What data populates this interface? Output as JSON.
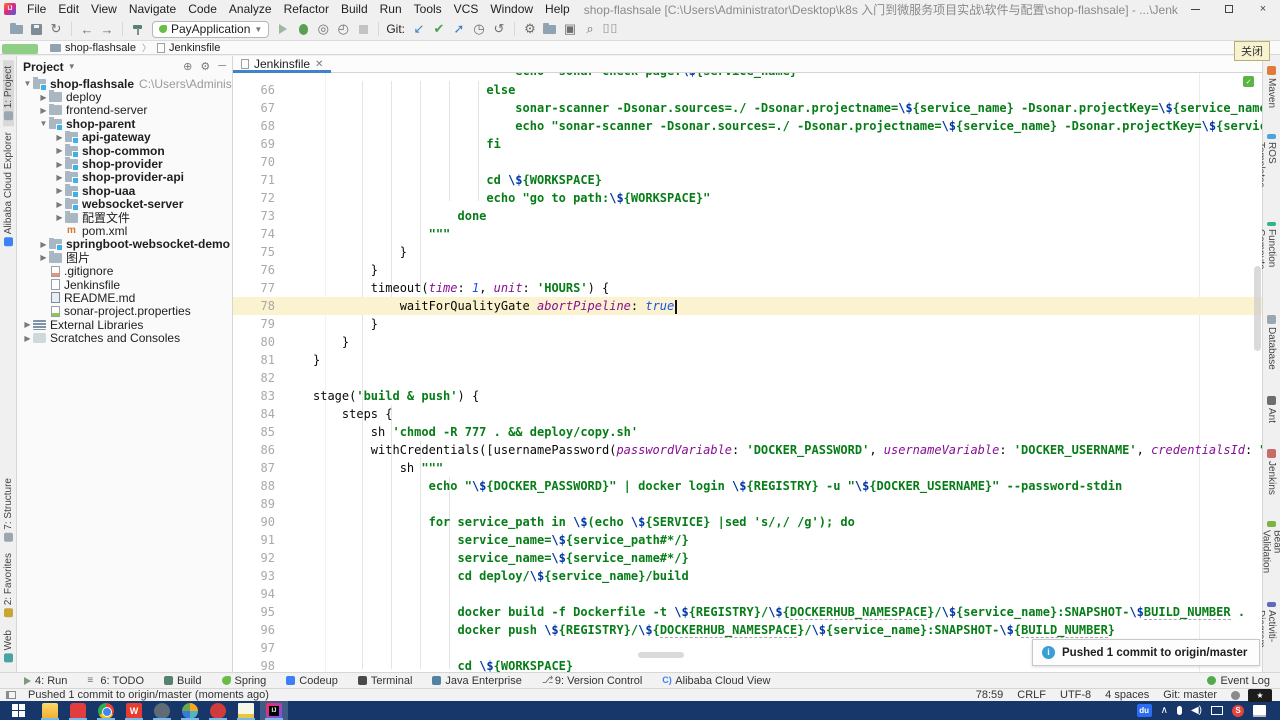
{
  "window": {
    "title": "shop-flashsale [C:\\Users\\Administrator\\Desktop\\k8s 入门到微服务项目实战\\软件与配置\\shop-flashsale] - ...\\Jenkinsfile [shop-flashsale] - IntelliJ IDEA (Administrator)",
    "menus": [
      "File",
      "Edit",
      "View",
      "Navigate",
      "Code",
      "Analyze",
      "Refactor",
      "Build",
      "Run",
      "Tools",
      "VCS",
      "Window",
      "Help"
    ]
  },
  "toolbar": {
    "run_config": "PayApplication",
    "git_label": "Git:"
  },
  "crumbs": {
    "items": [
      "shop-flashsale",
      "Jenkinsfile"
    ]
  },
  "tooltip": {
    "text": "关闭"
  },
  "strips": {
    "left_top": [
      {
        "label": "1: Project",
        "icon": "project",
        "active": true
      },
      {
        "label": "Alibaba Cloud Explorer",
        "icon": "alibaba",
        "active": false
      }
    ],
    "left_bottom": [
      {
        "label": "7: Structure",
        "icon": "structure",
        "active": false
      },
      {
        "label": "2: Favorites",
        "icon": "favorites",
        "active": false
      },
      {
        "label": "Web",
        "icon": "web",
        "active": false
      }
    ],
    "right": [
      {
        "label": "Maven",
        "icon": "maven"
      },
      {
        "label": "Alibaba ROS Templates",
        "icon": "ros"
      },
      {
        "label": "Alibaba Function Compute",
        "icon": "afc"
      },
      {
        "label": "Database",
        "icon": "db"
      },
      {
        "label": "Ant",
        "icon": "ant"
      },
      {
        "label": "Jenkins",
        "icon": "jenkins"
      },
      {
        "label": "Bean Validation",
        "icon": "bean"
      },
      {
        "label": "BPMN-Activiti-Diagram",
        "icon": "bpmn"
      }
    ]
  },
  "project": {
    "header": "Project",
    "items": [
      {
        "d": 0,
        "a": "v",
        "ic": "module",
        "b": 1,
        "t": "shop-flashsale",
        "x": "C:\\Users\\Administrator\\Desktop\\"
      },
      {
        "d": 1,
        "a": ">",
        "ic": "folder",
        "b": 0,
        "t": "deploy"
      },
      {
        "d": 1,
        "a": ">",
        "ic": "folder",
        "b": 0,
        "t": "frontend-server"
      },
      {
        "d": 1,
        "a": "v",
        "ic": "module",
        "b": 1,
        "t": "shop-parent"
      },
      {
        "d": 2,
        "a": ">",
        "ic": "module",
        "b": 1,
        "t": "api-gateway"
      },
      {
        "d": 2,
        "a": ">",
        "ic": "module",
        "b": 1,
        "t": "shop-common"
      },
      {
        "d": 2,
        "a": ">",
        "ic": "module",
        "b": 1,
        "t": "shop-provider"
      },
      {
        "d": 2,
        "a": ">",
        "ic": "module",
        "b": 1,
        "t": "shop-provider-api"
      },
      {
        "d": 2,
        "a": ">",
        "ic": "module",
        "b": 1,
        "t": "shop-uaa"
      },
      {
        "d": 2,
        "a": ">",
        "ic": "module",
        "b": 1,
        "t": "websocket-server"
      },
      {
        "d": 2,
        "a": ">",
        "ic": "folder",
        "b": 0,
        "t": "配置文件"
      },
      {
        "d": 2,
        "a": "",
        "ic": "maven",
        "b": 0,
        "t": "pom.xml"
      },
      {
        "d": 1,
        "a": ">",
        "ic": "module",
        "b": 1,
        "t": "springboot-websocket-demo"
      },
      {
        "d": 1,
        "a": ">",
        "ic": "folder",
        "b": 0,
        "t": "图片"
      },
      {
        "d": 1,
        "a": "",
        "ic": "git",
        "b": 0,
        "t": ".gitignore"
      },
      {
        "d": 1,
        "a": "",
        "ic": "file",
        "b": 0,
        "t": "Jenkinsfile"
      },
      {
        "d": 1,
        "a": "",
        "ic": "md",
        "b": 0,
        "t": "README.md"
      },
      {
        "d": 1,
        "a": "",
        "ic": "props",
        "b": 0,
        "t": "sonar-project.properties"
      },
      {
        "d": 0,
        "a": ">",
        "ic": "lib",
        "b": 0,
        "t": "External Libraries"
      },
      {
        "d": 0,
        "a": ">",
        "ic": "scr",
        "b": 0,
        "t": "Scratches and Consoles"
      }
    ]
  },
  "editor": {
    "tab": "Jenkinsfile",
    "partial_line": {
      "i": 28,
      "s": [
        [
          "s",
          "echo \"sonar check page:"
        ],
        [
          "e",
          "\\$"
        ],
        [
          "s",
          "{service_name}\""
        ]
      ]
    },
    "lines": [
      {
        "n": 66,
        "i": 24,
        "s": [
          [
            "s",
            "else"
          ]
        ]
      },
      {
        "n": 67,
        "i": 28,
        "s": [
          [
            "s",
            "sonar-scanner -Dsonar.sources=./ -Dsonar.projectname="
          ],
          [
            "e",
            "\\$"
          ],
          [
            "s",
            "{service_name} -Dsonar.projectKey="
          ],
          [
            "e",
            "\\$"
          ],
          [
            "s",
            "{service_name}"
          ]
        ]
      },
      {
        "n": 68,
        "i": 28,
        "s": [
          [
            "s",
            "echo \"sonar-scanner -Dsonar.sources=./ -Dsonar.projectname="
          ],
          [
            "e",
            "\\$"
          ],
          [
            "s",
            "{service_name} -Dsonar.projectKey="
          ],
          [
            "e",
            "\\$"
          ],
          [
            "s",
            "{service_name}\""
          ]
        ]
      },
      {
        "n": 69,
        "i": 24,
        "s": [
          [
            "s",
            "fi"
          ]
        ]
      },
      {
        "n": 70,
        "i": 0,
        "s": []
      },
      {
        "n": 71,
        "i": 24,
        "s": [
          [
            "s",
            "cd "
          ],
          [
            "e",
            "\\$"
          ],
          [
            "s",
            "{WORKSPACE}"
          ]
        ]
      },
      {
        "n": 72,
        "i": 24,
        "s": [
          [
            "s",
            "echo \"go to path:"
          ],
          [
            "e",
            "\\$"
          ],
          [
            "s",
            "{WORKSPACE}\""
          ]
        ]
      },
      {
        "n": 73,
        "i": 20,
        "s": [
          [
            "s",
            "done"
          ]
        ]
      },
      {
        "n": 74,
        "i": 16,
        "s": [
          [
            "s",
            "\"\"\""
          ]
        ]
      },
      {
        "n": 75,
        "i": 12,
        "s": [
          [
            "d",
            "}"
          ]
        ]
      },
      {
        "n": 76,
        "i": 8,
        "s": [
          [
            "d",
            "}"
          ]
        ]
      },
      {
        "n": 77,
        "i": 8,
        "s": [
          [
            "d",
            "timeout("
          ],
          [
            "p",
            "time"
          ],
          [
            "d",
            ": "
          ],
          [
            "n",
            "1"
          ],
          [
            "d",
            ", "
          ],
          [
            "p",
            "unit"
          ],
          [
            "d",
            ": "
          ],
          [
            "s",
            "'HOURS'"
          ],
          [
            "d",
            ") {"
          ]
        ]
      },
      {
        "n": 78,
        "i": 12,
        "h": true,
        "caret": true,
        "s": [
          [
            "d",
            "waitForQualityGate "
          ],
          [
            "p",
            "abortPipeline"
          ],
          [
            "d",
            ": "
          ],
          [
            "n",
            "true"
          ]
        ]
      },
      {
        "n": 79,
        "i": 8,
        "s": [
          [
            "d",
            "}"
          ]
        ]
      },
      {
        "n": 80,
        "i": 4,
        "s": [
          [
            "d",
            "}"
          ]
        ]
      },
      {
        "n": 81,
        "i": 0,
        "s": [
          [
            "d",
            "}"
          ]
        ]
      },
      {
        "n": 82,
        "i": 0,
        "s": []
      },
      {
        "n": 83,
        "i": 0,
        "s": [
          [
            "d",
            "stage("
          ],
          [
            "s",
            "'build & push'"
          ],
          [
            "d",
            ") {"
          ]
        ]
      },
      {
        "n": 84,
        "i": 4,
        "s": [
          [
            "d",
            "steps {"
          ]
        ]
      },
      {
        "n": 85,
        "i": 8,
        "s": [
          [
            "d",
            "sh "
          ],
          [
            "s",
            "'chmod -R 777 . && deploy/copy.sh'"
          ]
        ]
      },
      {
        "n": 86,
        "i": 8,
        "s": [
          [
            "d",
            "withCredentials([usernamePassword("
          ],
          [
            "p",
            "passwordVariable"
          ],
          [
            "d",
            ": "
          ],
          [
            "s",
            "'DOCKER_PASSWORD'"
          ],
          [
            "d",
            ", "
          ],
          [
            "p",
            "usernameVariable"
          ],
          [
            "d",
            ": "
          ],
          [
            "s",
            "'DOCKER_USERNAME'"
          ],
          [
            "d",
            ", "
          ],
          [
            "p",
            "credentialsId"
          ],
          [
            "d",
            ": "
          ],
          [
            "s",
            "\""
          ],
          [
            "e",
            "$DOCKER"
          ]
        ]
      },
      {
        "n": 87,
        "i": 12,
        "s": [
          [
            "d",
            "sh "
          ],
          [
            "s",
            "\"\"\""
          ]
        ]
      },
      {
        "n": 88,
        "i": 16,
        "s": [
          [
            "s",
            "echo \""
          ],
          [
            "e",
            "\\$"
          ],
          [
            "s",
            "{DOCKER_PASSWORD}\" | docker login "
          ],
          [
            "e",
            "\\$"
          ],
          [
            "s",
            "{REGISTRY} -u \""
          ],
          [
            "e",
            "\\$"
          ],
          [
            "s",
            "{DOCKER_USERNAME}\" --password-stdin"
          ]
        ]
      },
      {
        "n": 89,
        "i": 0,
        "s": []
      },
      {
        "n": 90,
        "i": 16,
        "s": [
          [
            "s",
            "for service_path in "
          ],
          [
            "e",
            "\\$"
          ],
          [
            "s",
            "(echo "
          ],
          [
            "e",
            "\\$"
          ],
          [
            "s",
            "{SERVICE} |sed 's/,/ /g'); do"
          ]
        ]
      },
      {
        "n": 91,
        "i": 20,
        "s": [
          [
            "s",
            "service_name="
          ],
          [
            "e",
            "\\$"
          ],
          [
            "s",
            "{service_path#*/}"
          ]
        ]
      },
      {
        "n": 92,
        "i": 20,
        "s": [
          [
            "s",
            "service_name="
          ],
          [
            "e",
            "\\$"
          ],
          [
            "s",
            "{service_name#*/}"
          ]
        ]
      },
      {
        "n": 93,
        "i": 20,
        "s": [
          [
            "s",
            "cd deploy/"
          ],
          [
            "e",
            "\\$"
          ],
          [
            "s",
            "{service_name}/build"
          ]
        ]
      },
      {
        "n": 94,
        "i": 0,
        "s": []
      },
      {
        "n": 95,
        "i": 20,
        "s": [
          [
            "s",
            "docker build -f Dockerfile -t "
          ],
          [
            "e",
            "\\$"
          ],
          [
            "s",
            "{REGISTRY}/"
          ],
          [
            "e",
            "\\$"
          ],
          [
            "s",
            "{"
          ],
          [
            "su",
            "DOCKERHUB_NAMESPACE"
          ],
          [
            "s",
            "}/"
          ],
          [
            "e",
            "\\$"
          ],
          [
            "s",
            "{service_name}:SNAPSHOT-"
          ],
          [
            "e",
            "\\$"
          ],
          [
            "su",
            "BUILD_NUMBER"
          ],
          [
            "s",
            " ."
          ]
        ]
      },
      {
        "n": 96,
        "i": 20,
        "s": [
          [
            "s",
            "docker push "
          ],
          [
            "e",
            "\\$"
          ],
          [
            "s",
            "{REGISTRY}/"
          ],
          [
            "e",
            "\\$"
          ],
          [
            "s",
            "{"
          ],
          [
            "su",
            "DOCKERHUB_NAMESPACE"
          ],
          [
            "s",
            "}/"
          ],
          [
            "e",
            "\\$"
          ],
          [
            "s",
            "{service_name}:SNAPSHOT-"
          ],
          [
            "e",
            "\\$"
          ],
          [
            "s",
            "{"
          ],
          [
            "su",
            "BUILD_NUMBER"
          ],
          [
            "s",
            "}"
          ]
        ]
      },
      {
        "n": 97,
        "i": 0,
        "s": []
      },
      {
        "n": 98,
        "i": 20,
        "s": [
          [
            "s",
            "cd "
          ],
          [
            "e",
            "\\$"
          ],
          [
            "s",
            "{WORKSPACE}"
          ]
        ]
      }
    ]
  },
  "toast": {
    "text": "Pushed 1 commit to origin/master"
  },
  "bottom_bar": {
    "items": [
      {
        "t": "4: Run",
        "ic": "run"
      },
      {
        "t": "6: TODO",
        "ic": "todo"
      },
      {
        "t": "Build",
        "ic": "build"
      },
      {
        "t": "Spring",
        "ic": "spring"
      },
      {
        "t": "Codeup",
        "ic": "codeup"
      },
      {
        "t": "Terminal",
        "ic": "terminal"
      },
      {
        "t": "Java Enterprise",
        "ic": "javaee"
      },
      {
        "t": "9: Version Control",
        "ic": "vcs"
      },
      {
        "t": "Alibaba Cloud View",
        "ic": "cloudview"
      }
    ],
    "right": {
      "t": "Event Log",
      "ic": "eventlog"
    }
  },
  "status_bar": {
    "message": "Pushed 1 commit to origin/master (moments ago)",
    "position": "78:59",
    "line_ending": "CRLF",
    "encoding": "UTF-8",
    "indent": "4 spaces",
    "branch": "Git: master"
  },
  "taskbar": {
    "apps": [
      "explorer",
      "mediaplayer",
      "chrome",
      "wps",
      "gear",
      "pinwheel",
      "petal",
      "notepad",
      "idea"
    ],
    "active_app": "idea",
    "wps_letter": "W",
    "tray": [
      "netdisk-du",
      "chevron-up",
      "microphone",
      "speaker",
      "monitor",
      "sogou",
      "ime-note"
    ]
  }
}
